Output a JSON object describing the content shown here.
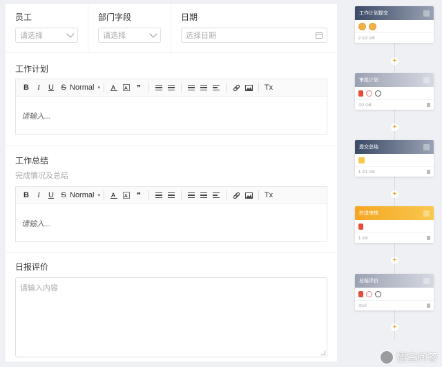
{
  "form": {
    "employee": {
      "label": "员工",
      "placeholder": "请选择"
    },
    "department": {
      "label": "部门字段",
      "placeholder": "请选择"
    },
    "date": {
      "label": "日期",
      "placeholder": "选择日期"
    },
    "plan": {
      "label": "工作计划",
      "placeholder": "请输入..."
    },
    "summary": {
      "label": "工作总结",
      "sublabel": "完成情况及总结",
      "placeholder": "请输入..."
    },
    "review": {
      "label": "日报评价",
      "placeholder": "请输入内容"
    },
    "toolbar": {
      "bold": "B",
      "italic": "I",
      "underline": "U",
      "strike": "S",
      "heading": "Normal",
      "quote": "❞",
      "clear": "Tx"
    }
  },
  "flow": {
    "nodes": [
      {
        "title": "工作计划提交",
        "stats": "2 ⊙2 ⊙6"
      },
      {
        "title": "审批计划",
        "stats": "⊙2 ⊙8"
      },
      {
        "title": "提交总结",
        "stats": "1 ⊙1 ⊙8"
      },
      {
        "title": "抄送审核",
        "stats": "1 ⊙9"
      },
      {
        "title": "总结评价",
        "stats": "⊙10"
      }
    ],
    "plus": "+"
  },
  "watermark": "悟空问答",
  "colors": {
    "accent": "#f5a623",
    "dark_header": "#3b4a66"
  }
}
